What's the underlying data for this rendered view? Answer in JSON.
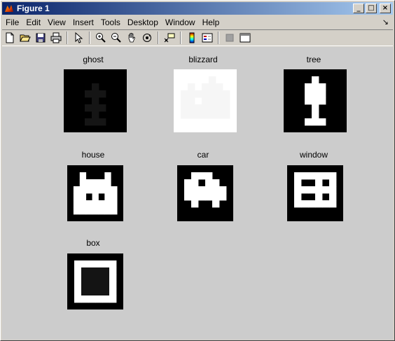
{
  "window": {
    "title": "Figure 1"
  },
  "caption_buttons": {
    "minimize": "_",
    "maximize": "□",
    "close": "×"
  },
  "menu": [
    "File",
    "Edit",
    "View",
    "Insert",
    "Tools",
    "Desktop",
    "Window",
    "Help"
  ],
  "dock_glyph": "↘",
  "toolbar": [
    "new-icon",
    "open-icon",
    "save-icon",
    "print-icon",
    "pointer-icon",
    "zoom-in-icon",
    "zoom-out-icon",
    "pan-icon",
    "rotate-icon",
    "data-cursor-icon",
    "colorbar-icon",
    "legend-icon",
    "hide-tools-icon",
    "show-tools-icon"
  ],
  "images": [
    {
      "title": "ghost",
      "fg": "#151515",
      "bg": "#000000",
      "pixels": [
        "000000000",
        "000000000",
        "000010000",
        "000111000",
        "000010000",
        "000111000",
        "000010000",
        "000111000",
        "000000000"
      ]
    },
    {
      "title": "blizzard",
      "fg": "#f6f6f6",
      "bg": "#ffffff",
      "pixels": [
        "000000000",
        "000001000",
        "001011100",
        "011111110",
        "011011110",
        "011111110",
        "011111110",
        "000000000",
        "000000000"
      ]
    },
    {
      "title": "tree",
      "fg": "#ffffff",
      "bg": "#000000",
      "pixels": [
        "000000000",
        "000010000",
        "000111000",
        "000111000",
        "000111000",
        "000010000",
        "000010000",
        "000111000",
        "000000000"
      ]
    },
    {
      "title": "house",
      "fg": "#ffffff",
      "bg": "#000000",
      "pixels": [
        "000000000",
        "001000100",
        "001111100",
        "011111110",
        "011010110",
        "011111110",
        "011111110",
        "000000000"
      ]
    },
    {
      "title": "car",
      "fg": "#ffffff",
      "bg": "#000000",
      "pixels": [
        "00000000",
        "00111000",
        "01101100",
        "01111110",
        "01111110",
        "00100100",
        "00000000",
        "00000000"
      ]
    },
    {
      "title": "window",
      "fg": "#ffffff",
      "bg": "#000000",
      "pixels": [
        "00000000",
        "01111110",
        "01001010",
        "01111110",
        "01001010",
        "01111110",
        "00000000",
        "00000000"
      ]
    },
    {
      "title": "box",
      "fg": "#ffffff",
      "bg": "#000000",
      "inner": "#141414",
      "pixels": [
        "00000000",
        "01111110",
        "01222210",
        "01222210",
        "01222210",
        "01222210",
        "01111110",
        "00000000"
      ]
    }
  ]
}
